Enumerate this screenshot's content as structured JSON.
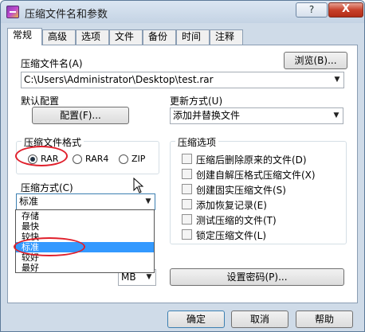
{
  "window": {
    "title": "压缩文件名和参数",
    "help_label": "?",
    "close_label": "X"
  },
  "tabs": [
    {
      "label": "常规",
      "active": true
    },
    {
      "label": "高级"
    },
    {
      "label": "选项"
    },
    {
      "label": "文件"
    },
    {
      "label": "备份"
    },
    {
      "label": "时间"
    },
    {
      "label": "注释"
    }
  ],
  "general": {
    "archive_name_label": "压缩文件名(A)",
    "browse_label": "浏览(B)...",
    "archive_name_value": "C:\\Users\\Administrator\\Desktop\\test.rar",
    "default_profile_label": "默认配置",
    "profile_button_label": "配置(F)...",
    "update_mode_label": "更新方式(U)",
    "update_mode_value": "添加并替换文件",
    "format_group_label": "压缩文件格式",
    "formats": [
      {
        "label": "RAR",
        "checked": true
      },
      {
        "label": "RAR4",
        "checked": false
      },
      {
        "label": "ZIP",
        "checked": false
      }
    ],
    "method_label": "压缩方式(C)",
    "method_value": "标准",
    "method_options": [
      "存储",
      "最快",
      "较快",
      "标准",
      "较好",
      "最好"
    ],
    "method_selected_index": 3,
    "split_unit_value": "MB",
    "options_group_label": "压缩选项",
    "options": [
      "压缩后删除原来的文件(D)",
      "创建自解压格式压缩文件(X)",
      "创建固实压缩文件(S)",
      "添加恢复记录(E)",
      "测试压缩的文件(T)",
      "锁定压缩文件(L)"
    ],
    "set_password_label": "设置密码(P)..."
  },
  "footer": {
    "ok_label": "确定",
    "cancel_label": "取消",
    "help_label": "帮助"
  },
  "colors": {
    "highlight": "#3399ff",
    "annotation": "#e0202c"
  }
}
